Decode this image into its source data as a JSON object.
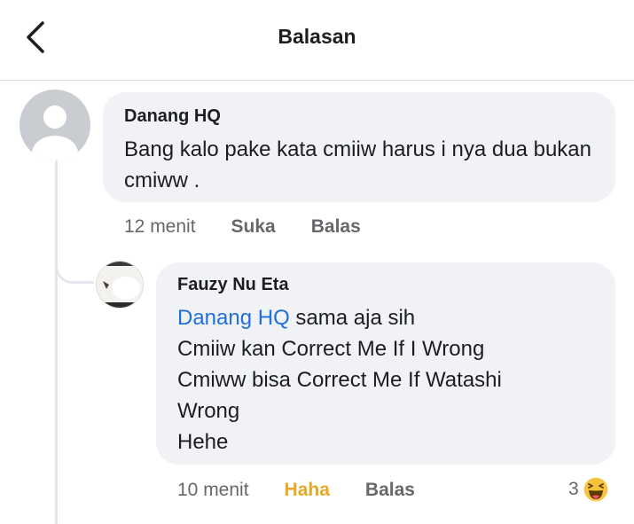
{
  "header": {
    "title": "Balasan"
  },
  "comments": [
    {
      "author": "Danang HQ",
      "text": "Bang kalo pake kata cmiiw harus i nya dua bukan cmiww .",
      "time": "12 menit",
      "like_label": "Suka",
      "reply_label": "Balas"
    },
    {
      "author": "Fauzy Nu Eta",
      "mention": "Danang HQ",
      "lines": [
        "sama aja sih",
        "Cmiiw kan Correct Me If I Wrong",
        "Cmiww bisa Correct Me If Watashi",
        "Wrong",
        "Hehe"
      ],
      "time": "10 menit",
      "like_label": "Haha",
      "reply_label": "Balas",
      "reaction_count": "3",
      "reaction_icon": "haha-emoji-icon"
    }
  ],
  "colors": {
    "background": "#ffffff",
    "bubble": "#f0f2f5",
    "mention": "#216fdb",
    "haha": "#e7a824",
    "meta": "#65676b"
  }
}
